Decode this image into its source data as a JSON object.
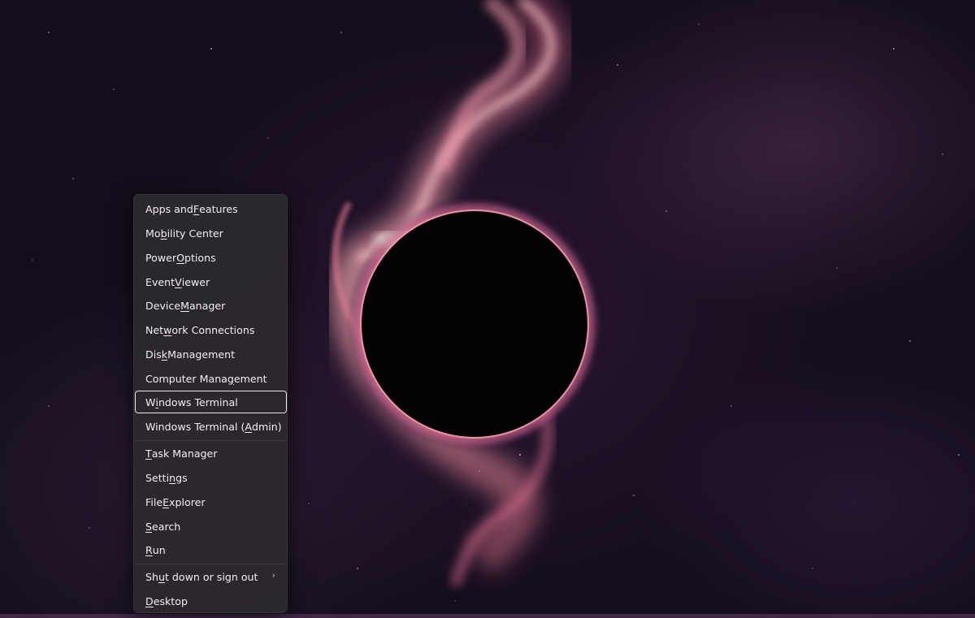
{
  "menu": {
    "items": [
      {
        "pre": "Apps and ",
        "key": "F",
        "post": "eatures"
      },
      {
        "pre": "Mo",
        "key": "b",
        "post": "ility Center"
      },
      {
        "pre": "Power ",
        "key": "O",
        "post": "ptions"
      },
      {
        "pre": "Event ",
        "key": "V",
        "post": "iewer"
      },
      {
        "pre": "Device ",
        "key": "M",
        "post": "anager"
      },
      {
        "pre": "Net",
        "key": "w",
        "post": "ork Connections"
      },
      {
        "pre": "Dis",
        "key": "k",
        "post": " Management"
      },
      {
        "pre": "Computer Mana",
        "key": "g",
        "post": "ement"
      },
      {
        "pre": "W",
        "key": "i",
        "post": "ndows Terminal"
      },
      {
        "pre": "Windows Terminal (",
        "key": "A",
        "post": "dmin)"
      },
      {
        "pre": "",
        "key": "T",
        "post": "ask Manager"
      },
      {
        "pre": "Setti",
        "key": "n",
        "post": "gs"
      },
      {
        "pre": "File ",
        "key": "E",
        "post": "xplorer"
      },
      {
        "pre": "",
        "key": "S",
        "post": "earch"
      },
      {
        "pre": "",
        "key": "R",
        "post": "un"
      },
      {
        "pre": "Sh",
        "key": "u",
        "post": "t down or sign out"
      },
      {
        "pre": "",
        "key": "D",
        "post": "esktop"
      }
    ],
    "focused_item": "Windows Terminal",
    "submenu_glyph": "›"
  },
  "colors": {
    "menu_background": "#2c2830",
    "menu_text": "#f1eef3",
    "focus_ring": "#e9e6ec",
    "nebula_accent": "#f48a9f"
  },
  "icons": {
    "submenu": "chevron-right-icon"
  }
}
